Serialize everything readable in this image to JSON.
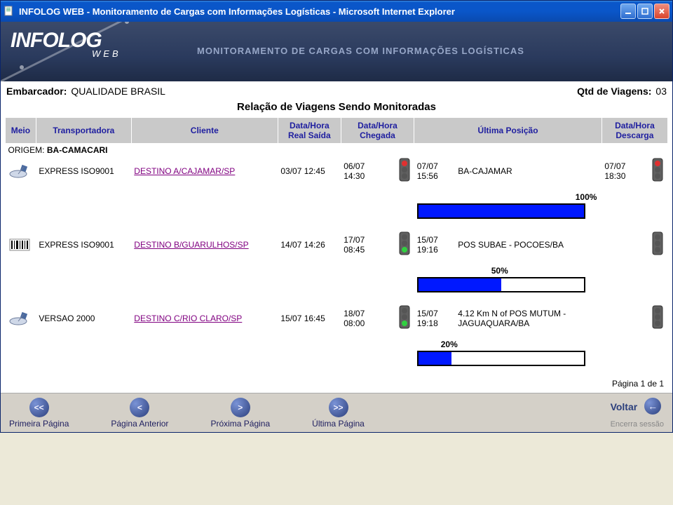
{
  "window": {
    "title": "INFOLOG WEB - Monitoramento de Cargas com Informações Logísticas - Microsoft Internet Explorer"
  },
  "brand": {
    "name": "INFOLOG",
    "sub": "WEB",
    "slogan": "MONITORAMENTO DE CARGAS COM INFORMAÇÕES LOGÍSTICAS"
  },
  "header": {
    "embarcador_label": "Embarcador:",
    "embarcador_value": "QUALIDADE BRASIL",
    "qtd_label": "Qtd de Viagens:",
    "qtd_value": "03"
  },
  "section_title": "Relação de Viagens Sendo Monitoradas",
  "columns": {
    "meio": "Meio",
    "transportadora": "Transportadora",
    "cliente": "Cliente",
    "saida": "Data/Hora Real Saída",
    "chegada": "Data/Hora Chegada",
    "ultima": "Última Posição",
    "descarga": "Data/Hora Descarga"
  },
  "origin": {
    "label": "ORIGEM:",
    "value": "BA-CAMACARI"
  },
  "trips": [
    {
      "icon": "satellite",
      "transportadora": "EXPRESS ISO9001",
      "cliente": "DESTINO A/CAJAMAR/SP",
      "saida": "03/07 12:45",
      "chegada": "06/07 14:30",
      "chegada_light": "red",
      "pos_time": "07/07 15:56",
      "pos_text": "BA-CAJAMAR",
      "descarga": "07/07 18:30",
      "descarga_light": "red",
      "progress": 100
    },
    {
      "icon": "barcode",
      "transportadora": "EXPRESS ISO9001",
      "cliente": "DESTINO B/GUARULHOS/SP",
      "saida": "14/07 14:26",
      "chegada": "17/07 08:45",
      "chegada_light": "green",
      "pos_time": "15/07 19:16",
      "pos_text": "POS SUBAE - POCOES/BA",
      "descarga": "",
      "descarga_light": "off",
      "progress": 50
    },
    {
      "icon": "satellite",
      "transportadora": "VERSAO 2000",
      "cliente": "DESTINO C/RIO CLARO/SP",
      "saida": "15/07 16:45",
      "chegada": "18/07 08:00",
      "chegada_light": "green",
      "pos_time": "15/07 19:18",
      "pos_text": "4.12 Km N of POS MUTUM - JAGUAQUARA/BA",
      "descarga": "",
      "descarga_light": "off",
      "progress": 20
    }
  ],
  "page_info": "Página 1 de 1",
  "footer": {
    "first": "Primeira Página",
    "prev": "Página Anterior",
    "next": "Próxima Página",
    "last": "Última Página",
    "voltar": "Voltar",
    "encerra": "Encerra sessão"
  }
}
